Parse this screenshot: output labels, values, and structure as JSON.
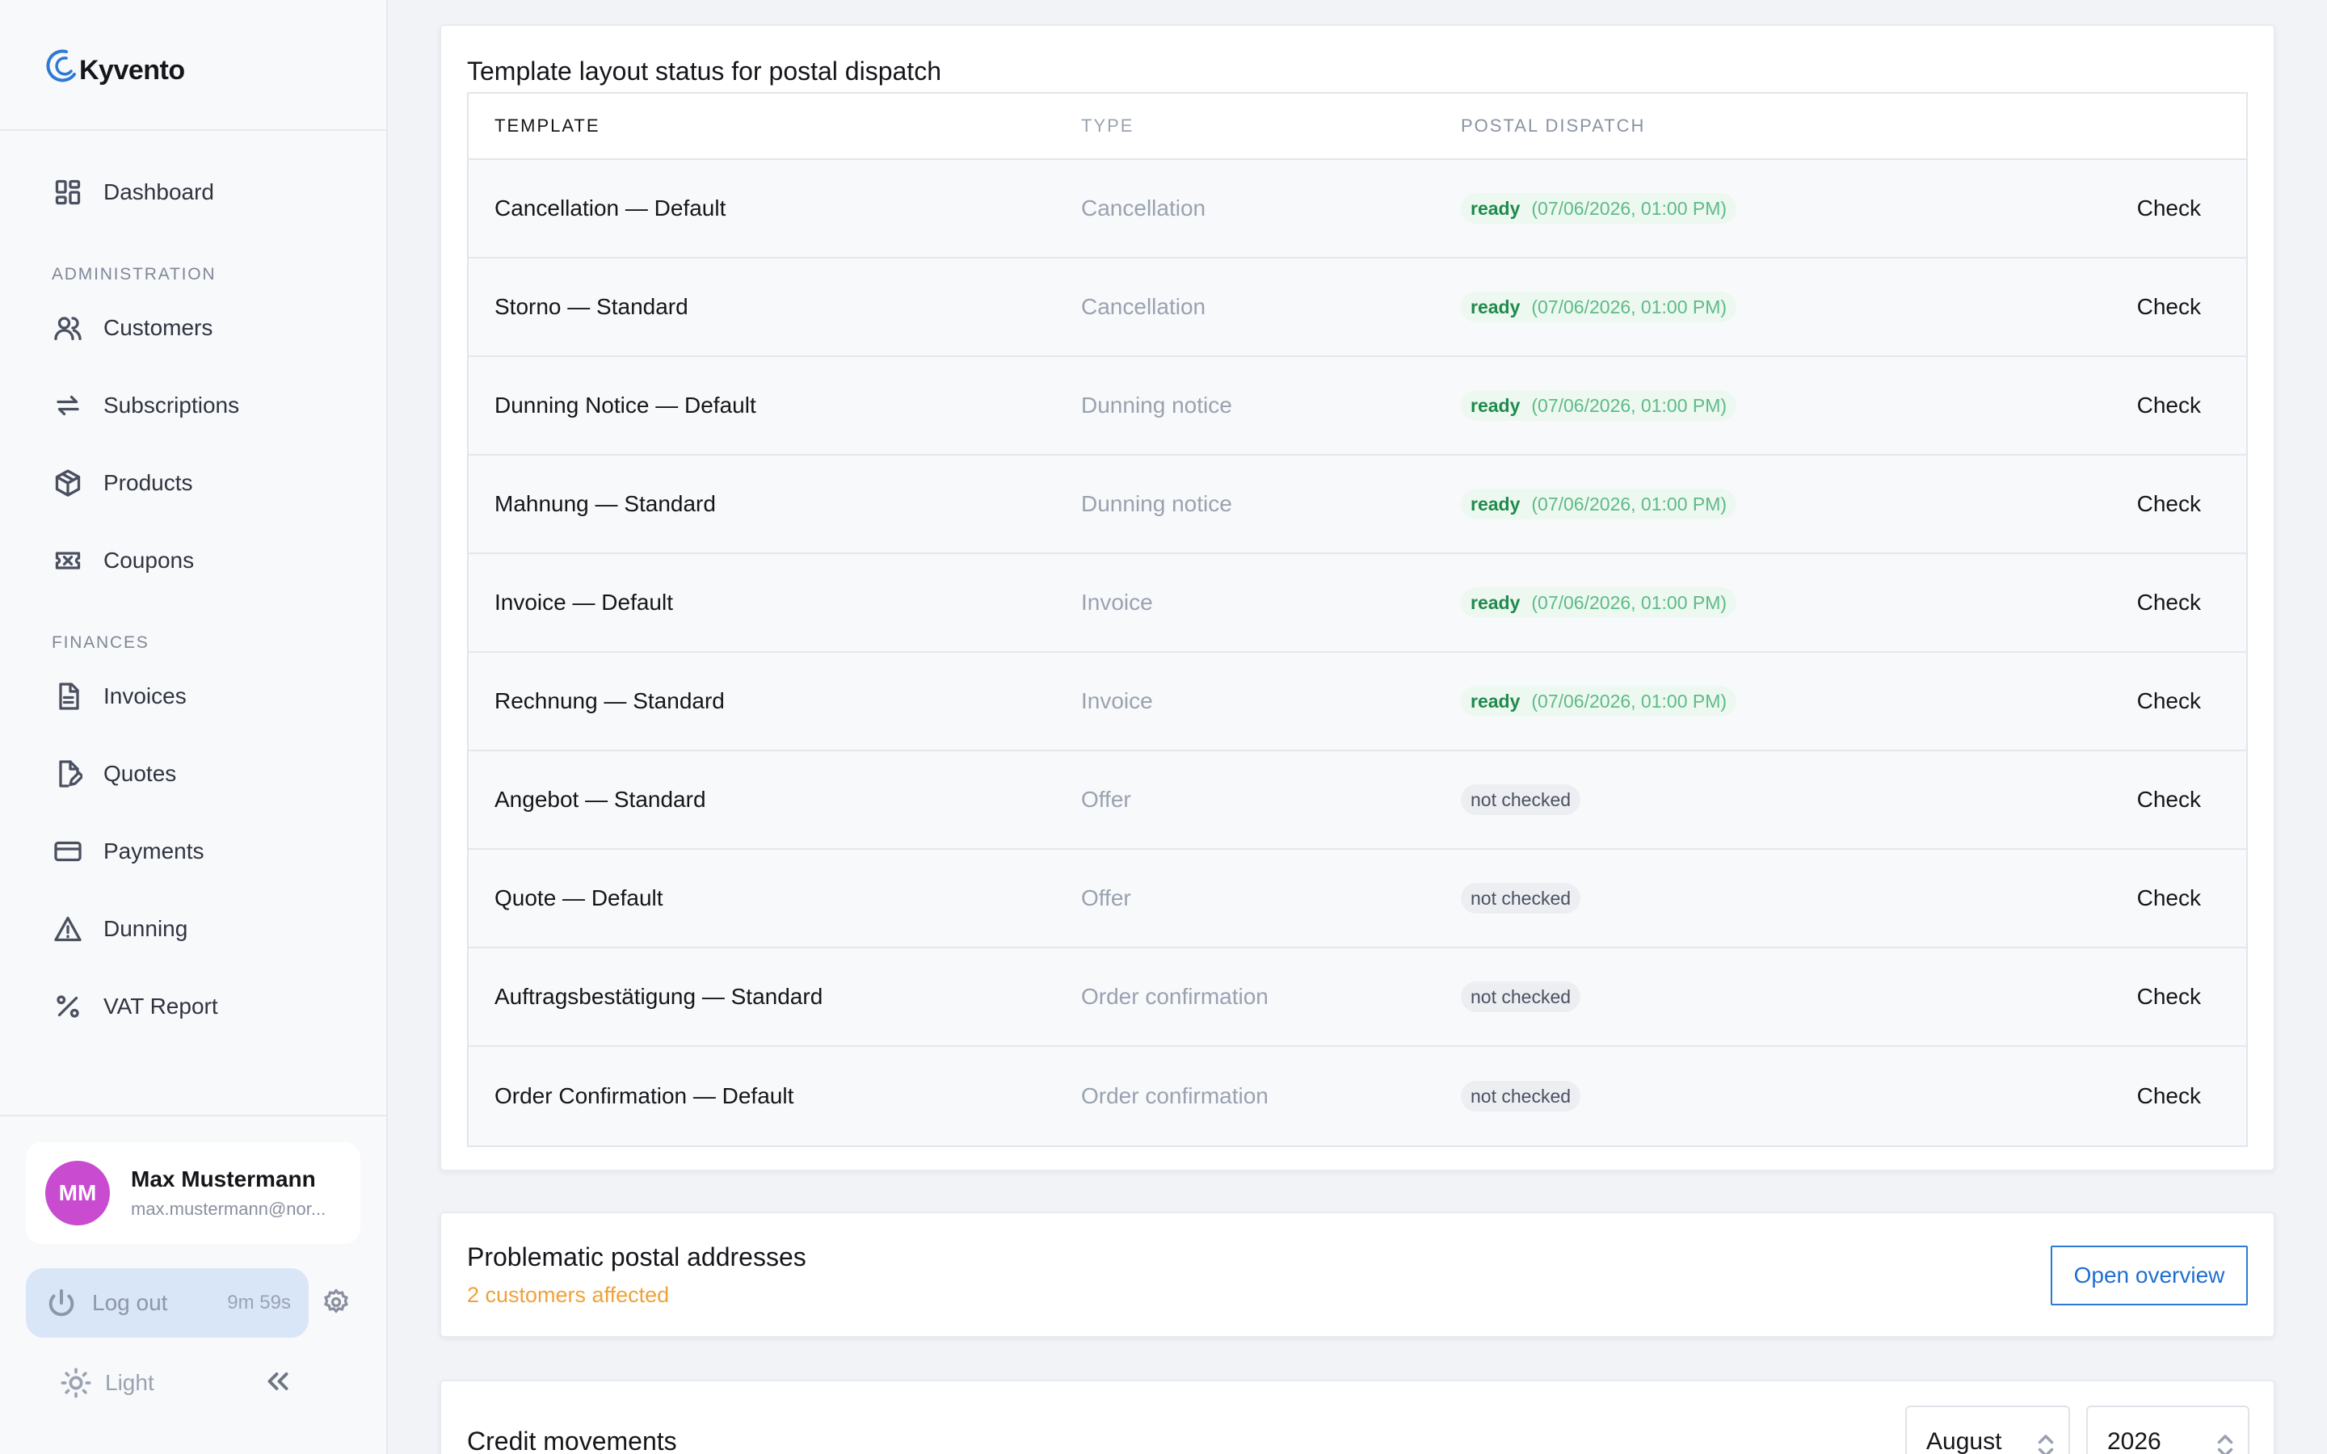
{
  "brand": {
    "name": "Kyvento"
  },
  "sidebar": {
    "items": [
      {
        "label": "Dashboard",
        "icon": "dashboard-icon"
      }
    ],
    "sections": [
      {
        "label": "ADMINISTRATION",
        "items": [
          {
            "label": "Customers",
            "icon": "users-icon"
          },
          {
            "label": "Subscriptions",
            "icon": "repeat-icon"
          },
          {
            "label": "Products",
            "icon": "box-icon"
          },
          {
            "label": "Coupons",
            "icon": "ticket-icon"
          }
        ]
      },
      {
        "label": "FINANCES",
        "items": [
          {
            "label": "Invoices",
            "icon": "document-icon"
          },
          {
            "label": "Quotes",
            "icon": "document-edit-icon"
          },
          {
            "label": "Payments",
            "icon": "credit-card-icon"
          },
          {
            "label": "Dunning",
            "icon": "warning-icon"
          },
          {
            "label": "VAT Report",
            "icon": "percent-icon"
          }
        ]
      }
    ],
    "user": {
      "initials": "MM",
      "name": "Max Mustermann",
      "email": "max.mustermann@nor...",
      "avatar_color": "#c94bd0"
    },
    "logout": {
      "label": "Log out",
      "timer": "9m 59s"
    },
    "theme": {
      "label": "Light"
    }
  },
  "template_status": {
    "title": "Template layout status for postal dispatch",
    "columns": [
      "TEMPLATE",
      "TYPE",
      "POSTAL DISPATCH"
    ],
    "rows": [
      {
        "name": "Cancellation — Default",
        "type": "Cancellation",
        "status": "ready",
        "timestamp": "(07/06/2026, 01:00 PM)",
        "action": "Check"
      },
      {
        "name": "Storno — Standard",
        "type": "Cancellation",
        "status": "ready",
        "timestamp": "(07/06/2026, 01:00 PM)",
        "action": "Check"
      },
      {
        "name": "Dunning Notice — Default",
        "type": "Dunning notice",
        "status": "ready",
        "timestamp": "(07/06/2026, 01:00 PM)",
        "action": "Check"
      },
      {
        "name": "Mahnung — Standard",
        "type": "Dunning notice",
        "status": "ready",
        "timestamp": "(07/06/2026, 01:00 PM)",
        "action": "Check"
      },
      {
        "name": "Invoice — Default",
        "type": "Invoice",
        "status": "ready",
        "timestamp": "(07/06/2026, 01:00 PM)",
        "action": "Check"
      },
      {
        "name": "Rechnung — Standard",
        "type": "Invoice",
        "status": "ready",
        "timestamp": "(07/06/2026, 01:00 PM)",
        "action": "Check"
      },
      {
        "name": "Angebot — Standard",
        "type": "Offer",
        "status": "not checked",
        "timestamp": "",
        "action": "Check"
      },
      {
        "name": "Quote — Default",
        "type": "Offer",
        "status": "not checked",
        "timestamp": "",
        "action": "Check"
      },
      {
        "name": "Auftragsbestätigung — Standard",
        "type": "Order confirmation",
        "status": "not checked",
        "timestamp": "",
        "action": "Check"
      },
      {
        "name": "Order Confirmation — Default",
        "type": "Order confirmation",
        "status": "not checked",
        "timestamp": "",
        "action": "Check"
      }
    ]
  },
  "postal_addresses": {
    "title": "Problematic postal addresses",
    "subtitle": "2 customers affected",
    "button": "Open overview"
  },
  "credit_movements": {
    "title": "Credit movements",
    "month": "August",
    "year": "2026"
  },
  "colors": {
    "accent": "#2c7ad6",
    "ready_text": "#1f8a4c",
    "warning_text": "#f0a23a"
  }
}
